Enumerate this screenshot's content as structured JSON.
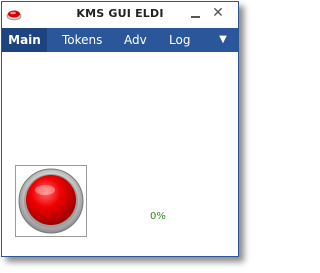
{
  "window": {
    "title": "KMS GUI ELDI",
    "minimize_label": "—",
    "close_label": "✕"
  },
  "nav": {
    "items": [
      {
        "label": "Main"
      },
      {
        "label": "Tokens"
      },
      {
        "label": "Adv"
      },
      {
        "label": "Log"
      }
    ],
    "menu_label": "▼"
  },
  "main": {
    "progress_text": "0%"
  },
  "icons": {
    "app": "red-button-icon",
    "activate": "red-round-button-icon"
  },
  "colors": {
    "nav_bar": "#2b579a",
    "nav_active": "#1e4480",
    "progress_text": "#2e8b1e",
    "button_red": "#e00000"
  }
}
